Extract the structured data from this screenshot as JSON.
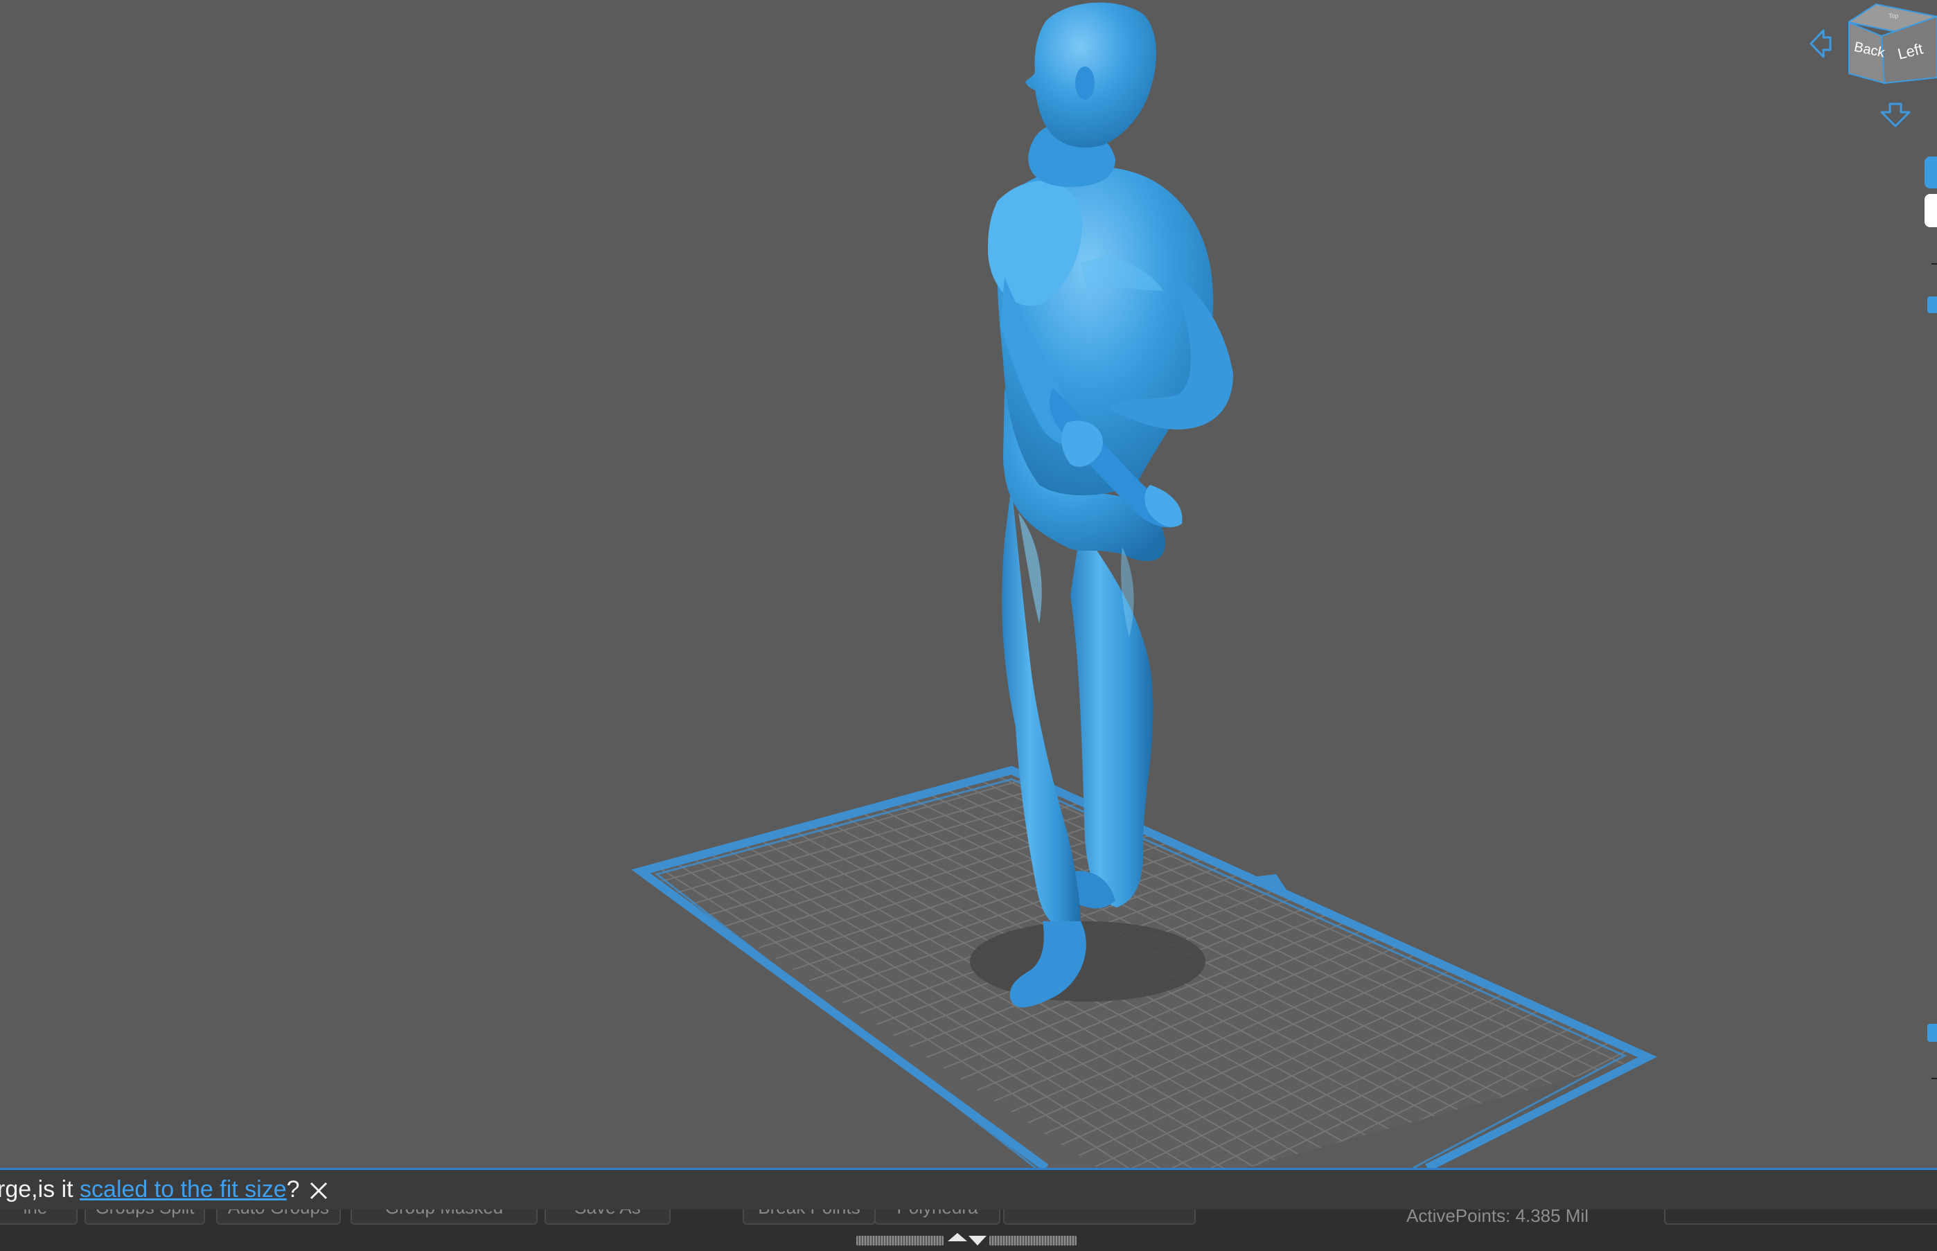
{
  "viewport": {
    "background_color": "#5b5b5b",
    "model_color": "#3a9ee0",
    "platform_border_color": "#3d8fd0",
    "platform_grid_color": "#737373"
  },
  "nav_cube": {
    "back_label": "Back",
    "left_label": "Left",
    "top_label": "Top",
    "accent_color": "#3d9be0"
  },
  "icons": {
    "rotate_left": "arrow-left-outline-icon",
    "rotate_down": "arrow-down-outline-icon",
    "close": "close-icon",
    "expand": "expand-collapse-icon"
  },
  "notification": {
    "prefix": "rge,is it ",
    "link_text": "scaled to the fit size",
    "suffix": "?",
    "link_color": "#3da0f2"
  },
  "toolbar": {
    "buttons": [
      {
        "label": "ine"
      },
      {
        "label": "Groups Split"
      },
      {
        "label": "Auto Groups"
      },
      {
        "label": "Group Masked"
      },
      {
        "label": "Save As"
      },
      {
        "label": "Break Points"
      },
      {
        "label": "Polyhedra"
      },
      {
        "label": ""
      }
    ],
    "active_points": "ActivePoints: 4.385 Mil"
  }
}
